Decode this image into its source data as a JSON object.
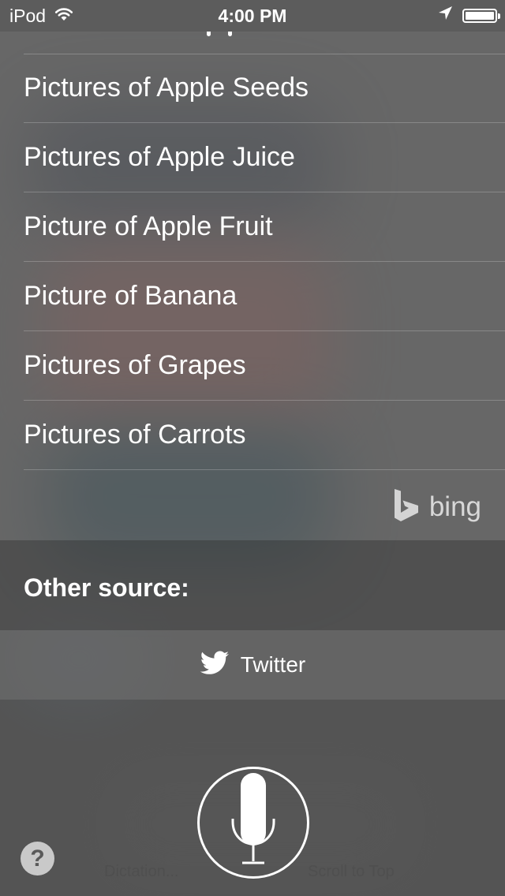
{
  "status_bar": {
    "device": "iPod",
    "time": "4:00 PM",
    "icons": [
      "wifi-icon",
      "location-arrow-icon",
      "battery-icon"
    ]
  },
  "suggestions": [
    "Pictures of Apple Seeds",
    "Pictures of Apple Juice",
    "Picture of Apple Fruit",
    "Picture of Banana",
    "Pictures of Grapes",
    "Pictures of Carrots"
  ],
  "bing": {
    "label": "bing",
    "icon": "bing-logo-icon"
  },
  "other_source": {
    "title": "Other source:",
    "twitter_label": "Twitter",
    "twitter_icon": "twitter-bird-icon"
  },
  "bottom": {
    "left_hint": "Dictation...",
    "right_hint": "Scroll to Top",
    "help_label": "?",
    "mic_icon": "microphone-icon"
  }
}
